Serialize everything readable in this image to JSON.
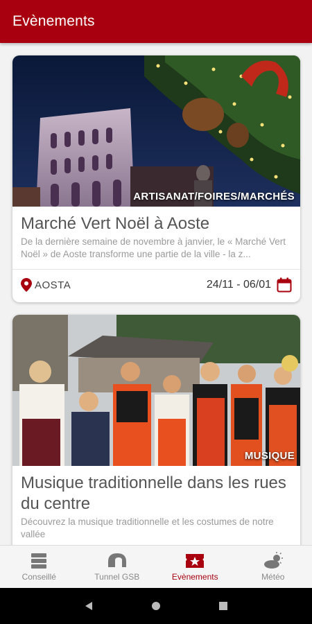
{
  "appbar": {
    "title": "Evènements"
  },
  "events": [
    {
      "category": "ARTISANAT/FOIRES/MARCHÉS",
      "title": "Marché Vert Noël à Aoste",
      "description": "De la dernière semaine de novembre à janvier, le « Marché Vert Noël » de Aoste transforme une partie de la ville - la z...",
      "location": "AOSTA",
      "dates": "24/11 - 06/01"
    },
    {
      "category": "MUSIQUE",
      "title": "Musique traditionnelle dans les rues du centre",
      "description": "Découvrez la musique traditionnelle et les costumes de notre vallée"
    }
  ],
  "nav": [
    {
      "label": "Conseillé",
      "icon": "list-icon"
    },
    {
      "label": "Tunnel GSB",
      "icon": "tunnel-icon"
    },
    {
      "label": "Evènements",
      "icon": "ticket-icon",
      "active": true
    },
    {
      "label": "Météo",
      "icon": "weather-icon"
    }
  ],
  "colors": {
    "primary": "#a8000e",
    "background": "#f2f2f2"
  }
}
